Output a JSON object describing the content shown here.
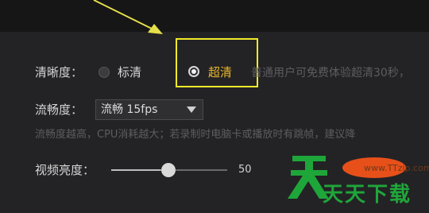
{
  "settings": {
    "clarity_label": "清晰度：",
    "clarity_options": [
      {
        "label": "标清",
        "selected": false
      },
      {
        "label": "超清",
        "selected": true
      }
    ],
    "clarity_hint": "普通用户可免费体验超清30秒，",
    "fluency_label": "流畅度：",
    "fluency_value": "流畅 15fps",
    "fluency_hint": "流畅度越高，CPU消耗越大；若录制时电脑卡或播放时有跳帧，建议降",
    "brightness_label": "视频亮度：",
    "brightness_value": "50"
  },
  "watermark": {
    "text": "天天下载",
    "url": "www.TTzip.com"
  },
  "colors": {
    "highlight_box": "#f3ea2b",
    "arrow": "#e6e04a",
    "selected_text": "#e8b52a",
    "watermark_green": "#1fa63a",
    "watermark_orange": "#e8501a"
  },
  "icons": {
    "annotation_arrow": "arrow-icon",
    "dropdown": "chevron-down-icon"
  }
}
